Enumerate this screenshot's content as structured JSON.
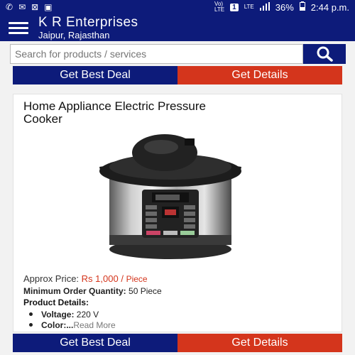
{
  "status_bar": {
    "left_icons": [
      "whatsapp-icon",
      "mail-icon",
      "close-box-icon",
      "image-icon"
    ],
    "volte_label": "Vo)\nLTE",
    "sim_badge": "1",
    "lte_label": "LTE",
    "signal": "signal-icon",
    "battery": "36%",
    "time": "2:44 p.m."
  },
  "header": {
    "title": "K R Enterprises",
    "subtitle": "Jaipur, Rajasthan"
  },
  "search": {
    "placeholder": "Search for products / services"
  },
  "top_cta": {
    "deal_label": "Get Best Deal",
    "details_label": "Get Details"
  },
  "product": {
    "title": "Home Appliance Electric Pressure Cooker",
    "price_label": "Approx Price:",
    "price": "Rs 1,000 /",
    "price_unit": "Piece",
    "moq_label": "Minimum Order Quantity:",
    "moq_value": "50 Piece",
    "details_heading": "Product Details:",
    "details": [
      {
        "label": "Voltage:",
        "value": "220 V"
      },
      {
        "label": "Color:",
        "value": "...",
        "more": "Read More"
      }
    ]
  },
  "bottom_cta": {
    "deal_label": "Get Best Deal",
    "details_label": "Get Details"
  },
  "colors": {
    "brand_blue": "#0d1b7a",
    "accent_red": "#d4351c"
  }
}
